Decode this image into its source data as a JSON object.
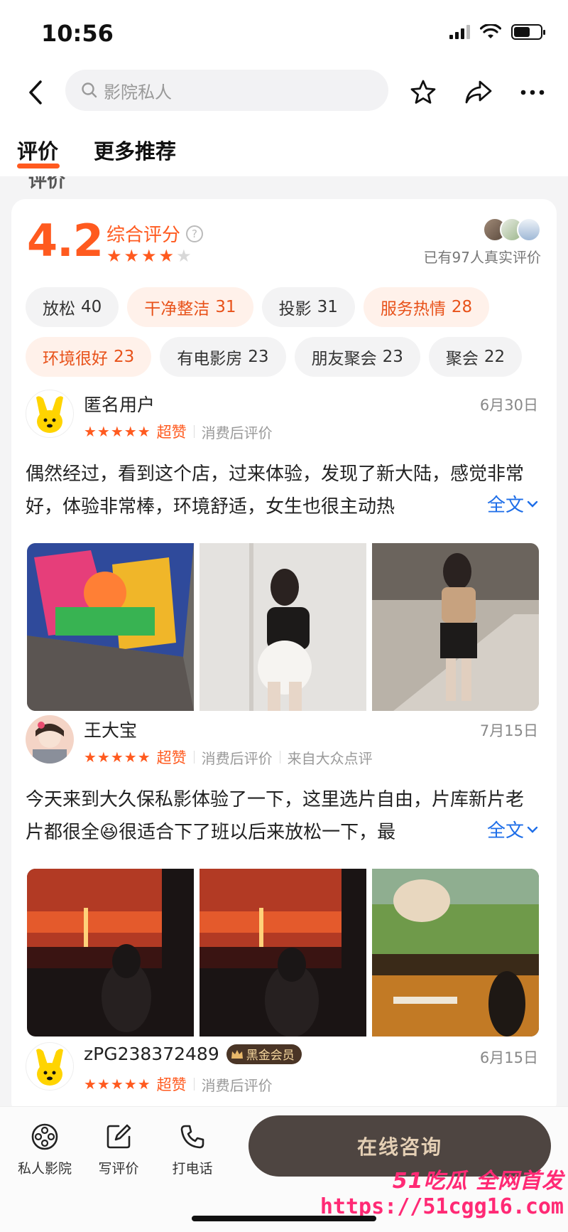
{
  "status": {
    "time": "10:56"
  },
  "nav": {
    "search_placeholder": "影院私人"
  },
  "tabs": [
    {
      "label": "评价"
    },
    {
      "label": "更多推荐"
    }
  ],
  "summary": {
    "score": "4.2",
    "score_label": "综合评分",
    "stars_filled": 4,
    "stars_total": 5,
    "real_review_count": "已有97人真实评价"
  },
  "tags": [
    {
      "label": "放松",
      "count": "40",
      "highlight": false
    },
    {
      "label": "干净整洁",
      "count": "31",
      "highlight": true
    },
    {
      "label": "投影",
      "count": "31",
      "highlight": false
    },
    {
      "label": "服务热情",
      "count": "28",
      "highlight": true
    },
    {
      "label": "环境很好",
      "count": "23",
      "highlight": true
    },
    {
      "label": "有电影房",
      "count": "23",
      "highlight": false
    },
    {
      "label": "朋友聚会",
      "count": "23",
      "highlight": false
    },
    {
      "label": "聚会",
      "count": "22",
      "highlight": false
    }
  ],
  "reviews": [
    {
      "user": "匿名用户",
      "date": "6月30日",
      "rating_badge": "超赞",
      "meta": "消费后评价",
      "text": "偶然经过，看到这个店，过来体验，发现了新大陆，感觉非常好，体验非常棒，环境舒适，女生也很主动热",
      "more": "全文"
    },
    {
      "user": "王大宝",
      "date": "7月15日",
      "rating_badge": "超赞",
      "meta": "消费后评价",
      "source": "来自大众点评",
      "text": "今天来到大久保私影体验了一下，这里选片自由，片库新片老片都很全😆很适合下了班以后来放松一下，最",
      "more": "全文"
    },
    {
      "user": "zPG238372489",
      "vip": "黑金会员",
      "date": "6月15日",
      "rating_badge": "超赞",
      "meta": "消费后评价"
    }
  ],
  "bottom": {
    "items": [
      {
        "label": "私人影院"
      },
      {
        "label": "写评价"
      },
      {
        "label": "打电话"
      }
    ],
    "consult": "在线咨询"
  },
  "watermark": {
    "line1": "51吃瓜 全网首发",
    "line2": "https://51cgg16.com"
  }
}
